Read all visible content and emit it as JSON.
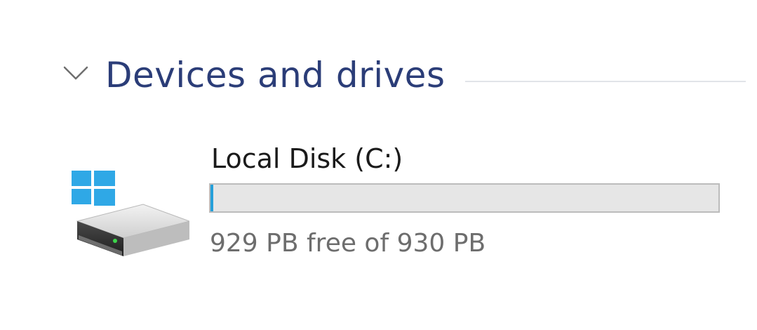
{
  "section": {
    "title": "Devices and drives",
    "expanded": true
  },
  "drive": {
    "name": "Local Disk (C:)",
    "space_text": "929 PB free of 930 PB",
    "used_fraction": 0.0011,
    "icon": "windows-hard-drive-icon"
  },
  "colors": {
    "section_title": "#2b3d78",
    "usage_fill": "#26a0da",
    "windows_logo": "#2fa8e6"
  }
}
